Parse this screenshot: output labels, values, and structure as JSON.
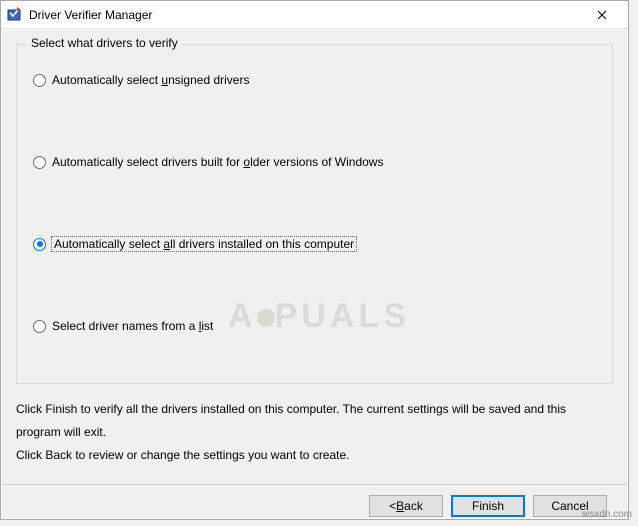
{
  "window": {
    "title": "Driver Verifier Manager",
    "close_label": "✕"
  },
  "group": {
    "title": "Select what drivers to verify",
    "options": [
      {
        "pre": "Automatically select ",
        "accel": "u",
        "post": "nsigned drivers",
        "checked": false
      },
      {
        "pre": "Automatically select drivers built for ",
        "accel": "o",
        "post": "lder versions of Windows",
        "checked": false
      },
      {
        "pre": "Automatically select ",
        "accel": "a",
        "post": "ll drivers installed on this computer",
        "checked": true
      },
      {
        "pre": "Select driver names from a ",
        "accel": "l",
        "post": "ist",
        "checked": false
      }
    ]
  },
  "help": {
    "line1": "Click Finish to verify all the drivers installed on this computer. The current settings will be saved and this program will exit.",
    "line2": "Click Back to review or change the settings you want to create."
  },
  "buttons": {
    "back_accel": "B",
    "back_rest": "ack",
    "back_prefix": "< ",
    "finish": "Finish",
    "cancel": "Cancel"
  },
  "watermark": "A  PUALS",
  "credit": "wsxdn.com"
}
